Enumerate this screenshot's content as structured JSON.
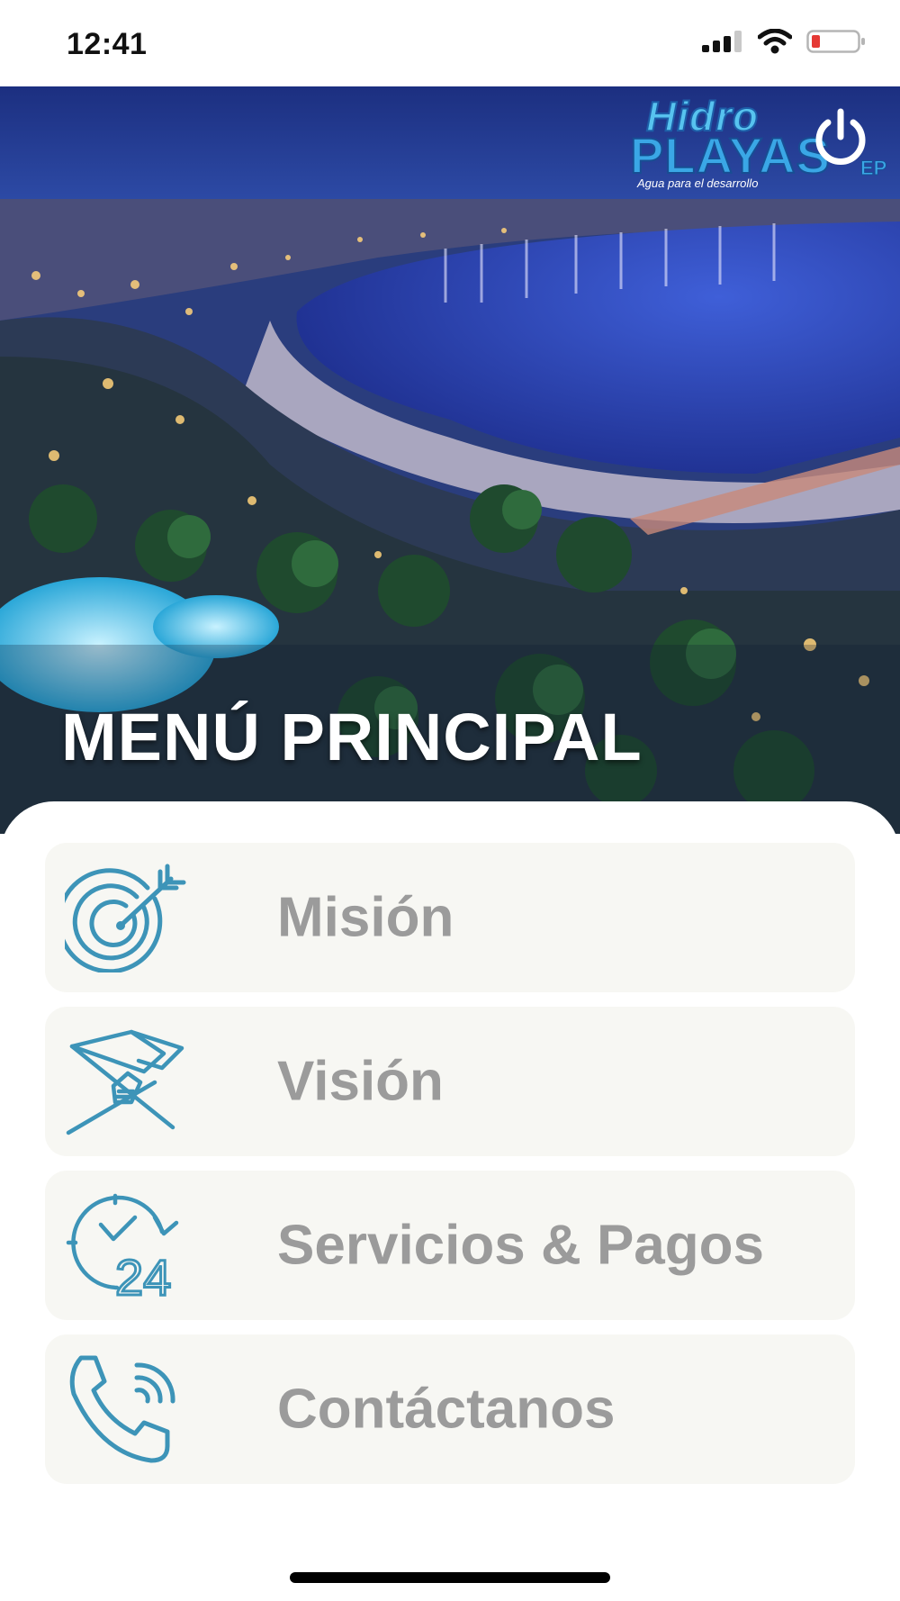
{
  "status_bar": {
    "time": "12:41",
    "icons": [
      "signal-icon",
      "wifi-icon",
      "battery-low-icon"
    ]
  },
  "header": {
    "title": "MENÚ PRINCIPAL",
    "logo": {
      "line1": "Hidro",
      "line2": "PLAYAS",
      "suffix": "EP",
      "tagline": "Agua para el desarrollo"
    },
    "power_icon": "power-icon"
  },
  "menu": {
    "items": [
      {
        "label": "Misión",
        "icon": "target-icon"
      },
      {
        "label": "Visión",
        "icon": "flag-hand-icon"
      },
      {
        "label": "Servicios & Pagos",
        "icon": "clock-24-icon"
      },
      {
        "label": "Contáctanos",
        "icon": "phone-call-icon"
      }
    ]
  },
  "colors": {
    "icon_accent": "#3d94b8",
    "menu_label": "#9b9b9b",
    "menu_bg": "#f7f7f3",
    "logo_blue": "#3aa7e6"
  }
}
